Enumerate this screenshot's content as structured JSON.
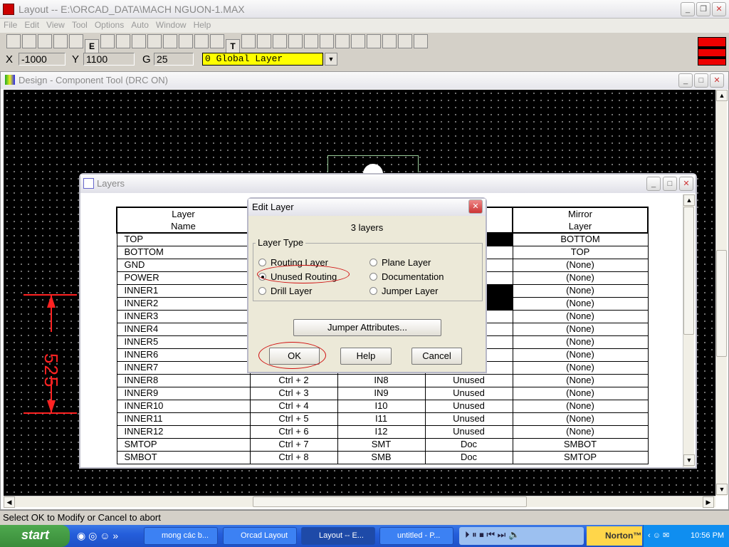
{
  "app": {
    "title": "Layout -- E:\\ORCAD_DATA\\MACH NGUON-1.MAX"
  },
  "menu": [
    "File",
    "Edit",
    "View",
    "Tool",
    "Options",
    "Auto",
    "Window",
    "Help"
  ],
  "toolbar": [
    "open",
    "save",
    "stats",
    "x",
    "binoculars",
    "E",
    "grid",
    "zoom-in",
    "zoom-out",
    "zoom-all",
    "Q",
    "component",
    "pin",
    "obstacle",
    "T",
    "dimension",
    "erase",
    "colors",
    "DRC",
    "reconnect",
    "shove",
    "pin-swap",
    "route",
    "auto",
    "online-drc",
    "drc-check",
    "SF"
  ],
  "coords": {
    "x_label": "X",
    "x_value": "-1000",
    "y_label": "Y",
    "y_value": "1100",
    "g_label": "G",
    "g_value": "25",
    "layer": "0 Global Layer"
  },
  "design": {
    "title": "Design - Component Tool (DRC ON)",
    "dimension": "525",
    "dim_color": "#ff2020"
  },
  "layers": {
    "title": "Layers",
    "headers": [
      "Layer\nName",
      "",
      "",
      "",
      "Mirror\nLayer"
    ],
    "rows": [
      [
        "TOP",
        "",
        "",
        "black",
        "BOTTOM"
      ],
      [
        "BOTTOM",
        "",
        "",
        "",
        "TOP"
      ],
      [
        "GND",
        "",
        "",
        "",
        "(None)"
      ],
      [
        "POWER",
        "",
        "",
        "",
        "(None)"
      ],
      [
        "INNER1",
        "",
        "",
        "black",
        "(None)"
      ],
      [
        "INNER2",
        "",
        "",
        "black",
        "(None)"
      ],
      [
        "INNER3",
        "",
        "",
        "",
        "(None)"
      ],
      [
        "INNER4",
        "",
        "",
        "",
        "(None)"
      ],
      [
        "INNER5",
        "",
        "",
        "",
        "(None)"
      ],
      [
        "INNER6",
        "",
        "",
        "",
        "(None)"
      ],
      [
        "INNER7",
        "",
        "",
        "",
        "(None)"
      ],
      [
        "INNER8",
        "Ctrl + 2",
        "IN8",
        "Unused",
        "(None)"
      ],
      [
        "INNER9",
        "Ctrl + 3",
        "IN9",
        "Unused",
        "(None)"
      ],
      [
        "INNER10",
        "Ctrl + 4",
        "I10",
        "Unused",
        "(None)"
      ],
      [
        "INNER11",
        "Ctrl + 5",
        "I11",
        "Unused",
        "(None)"
      ],
      [
        "INNER12",
        "Ctrl + 6",
        "I12",
        "Unused",
        "(None)"
      ],
      [
        "SMTOP",
        "Ctrl + 7",
        "SMT",
        "Doc",
        "SMBOT"
      ],
      [
        "SMBOT",
        "Ctrl + 8",
        "SMB",
        "Doc",
        "SMTOP"
      ]
    ]
  },
  "dialog": {
    "title": "Edit Layer",
    "count": "3 layers",
    "group": "Layer Type",
    "options": [
      {
        "label": "Routing Layer",
        "selected": false
      },
      {
        "label": "Plane Layer",
        "selected": false
      },
      {
        "label": "Unused Routing",
        "selected": true
      },
      {
        "label": "Documentation",
        "selected": false
      },
      {
        "label": "Drill Layer",
        "selected": false
      },
      {
        "label": "Jumper Layer",
        "selected": false
      }
    ],
    "jumper": "Jumper Attributes...",
    "ok": "OK",
    "help": "Help",
    "cancel": "Cancel"
  },
  "status": "Select OK to Modify or Cancel to abort",
  "taskbar": {
    "start": "start",
    "tasks": [
      "mong các b...",
      "Orcad Layout",
      "Layout -- E...",
      "untitled - P..."
    ],
    "norton": "Norton™",
    "time": "10:56 PM"
  }
}
